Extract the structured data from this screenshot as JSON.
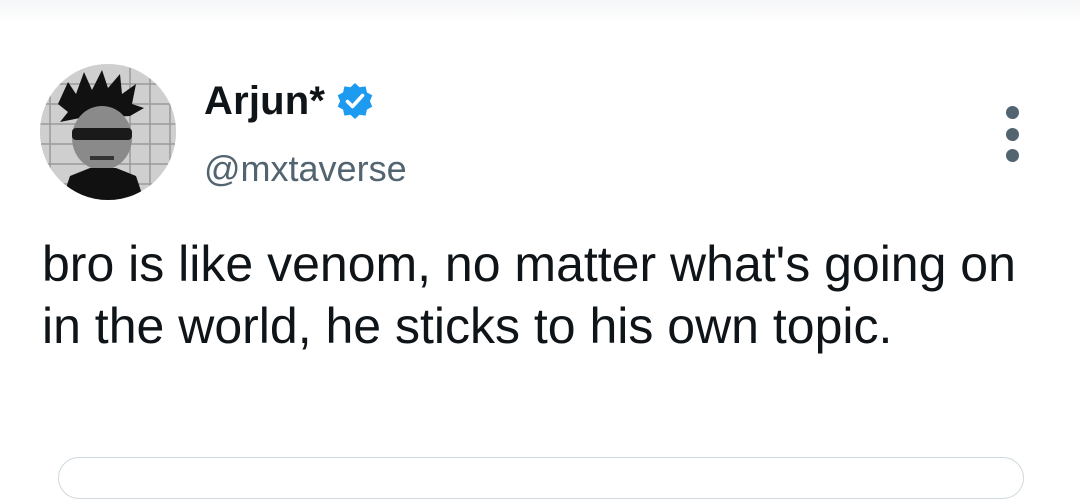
{
  "tweet": {
    "author": {
      "display_name": "Arjun*",
      "handle": "@mxtaverse",
      "verified": true,
      "avatar_icon": "profile-photo",
      "verified_icon": "verified-badge-icon"
    },
    "text": "bro is like venom, no matter what's going on in the world, he sticks to his own topic.",
    "more_icon": "more-options-icon"
  },
  "colors": {
    "text_primary": "#0f1419",
    "text_secondary": "#536471",
    "verified_blue": "#1d9bf0",
    "border": "#cfd9de"
  }
}
